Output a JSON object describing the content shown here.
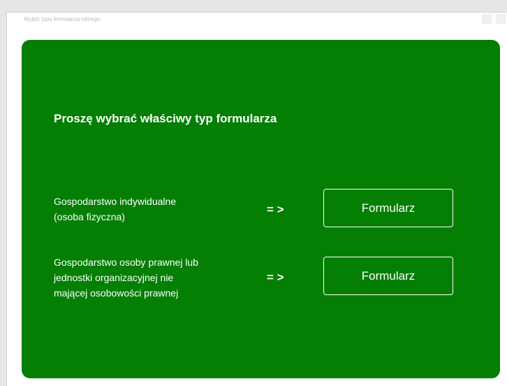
{
  "window": {
    "title": "Wybór typu formularza rolnego"
  },
  "main": {
    "heading": "Proszę wybrać właściwy typ formularza",
    "options": [
      {
        "label": "Gospodarstwo indywidualne\n(osoba fizyczna)",
        "arrow": "= >",
        "button_label": "Formularz"
      },
      {
        "label": "Gospodarstwo osoby prawnej lub\njednostki organizacyjnej nie\nmającej osobowości prawnej",
        "arrow": "= >",
        "button_label": "Formularz"
      }
    ]
  },
  "colors": {
    "panel_background": "#047f04",
    "text": "#ffffff"
  }
}
